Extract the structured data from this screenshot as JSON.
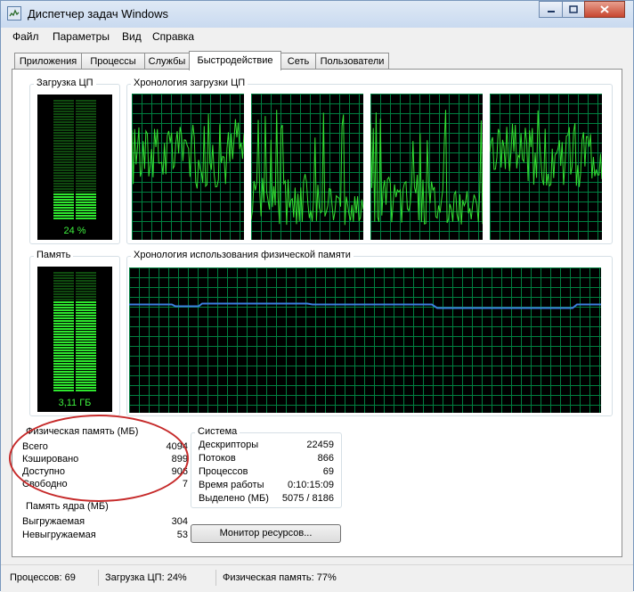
{
  "window": {
    "title": "Диспетчер задач Windows"
  },
  "menu": [
    "Файл",
    "Параметры",
    "Вид",
    "Справка"
  ],
  "tabs": [
    "Приложения",
    "Процессы",
    "Службы",
    "Быстродействие",
    "Сеть",
    "Пользователи"
  ],
  "active_tab": "Быстродействие",
  "cpu": {
    "usage_title": "Загрузка ЦП",
    "usage_value": "24 %",
    "usage_fraction": 0.24,
    "history_title": "Хронология загрузки ЦП"
  },
  "memory": {
    "usage_title": "Память",
    "usage_value": "3,11 ГБ",
    "usage_fraction": 0.77,
    "history_title": "Хронология использования физической памяти"
  },
  "physical_memory": {
    "title": "Физическая память (МБ)",
    "rows": [
      {
        "label": "Всего",
        "value": "4094"
      },
      {
        "label": "Кэшировано",
        "value": "899"
      },
      {
        "label": "Доступно",
        "value": "906"
      },
      {
        "label": "Свободно",
        "value": "7"
      }
    ]
  },
  "kernel_memory": {
    "title": "Память ядра (МБ)",
    "rows": [
      {
        "label": "Выгружаемая",
        "value": "304"
      },
      {
        "label": "Невыгружаемая",
        "value": "53"
      }
    ]
  },
  "system": {
    "title": "Система",
    "rows": [
      {
        "label": "Дескрипторы",
        "value": "22459"
      },
      {
        "label": "Потоков",
        "value": "866"
      },
      {
        "label": "Процессов",
        "value": "69"
      },
      {
        "label": "Время работы",
        "value": "0:10:15:09"
      },
      {
        "label": "Выделено (МБ)",
        "value": "5075 / 8186"
      }
    ]
  },
  "resource_monitor_button": "Монитор ресурсов...",
  "status": {
    "processes": "Процессов: 69",
    "cpu": "Загрузка ЦП: 24%",
    "memory": "Физическая память: 77%"
  },
  "colors": {
    "graph_bg": "#000000",
    "grid": "#008040",
    "cpu_line": "#33e033",
    "memory_line": "#3c7ee0",
    "annotation": "#c62a2a"
  }
}
